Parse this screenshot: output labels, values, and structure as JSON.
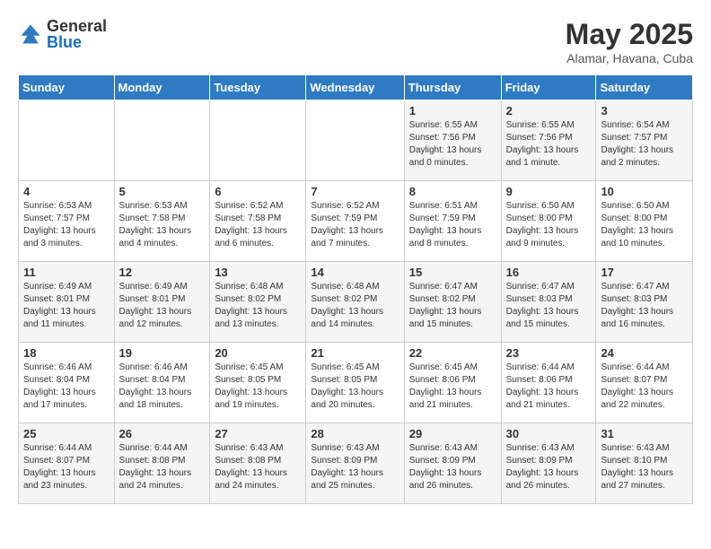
{
  "logo": {
    "general": "General",
    "blue": "Blue"
  },
  "title": "May 2025",
  "location": "Alamar, Havana, Cuba",
  "weekdays": [
    "Sunday",
    "Monday",
    "Tuesday",
    "Wednesday",
    "Thursday",
    "Friday",
    "Saturday"
  ],
  "weeks": [
    [
      {
        "day": "",
        "info": ""
      },
      {
        "day": "",
        "info": ""
      },
      {
        "day": "",
        "info": ""
      },
      {
        "day": "",
        "info": ""
      },
      {
        "day": "1",
        "info": "Sunrise: 6:55 AM\nSunset: 7:56 PM\nDaylight: 13 hours\nand 0 minutes."
      },
      {
        "day": "2",
        "info": "Sunrise: 6:55 AM\nSunset: 7:56 PM\nDaylight: 13 hours\nand 1 minute."
      },
      {
        "day": "3",
        "info": "Sunrise: 6:54 AM\nSunset: 7:57 PM\nDaylight: 13 hours\nand 2 minutes."
      }
    ],
    [
      {
        "day": "4",
        "info": "Sunrise: 6:53 AM\nSunset: 7:57 PM\nDaylight: 13 hours\nand 3 minutes."
      },
      {
        "day": "5",
        "info": "Sunrise: 6:53 AM\nSunset: 7:58 PM\nDaylight: 13 hours\nand 4 minutes."
      },
      {
        "day": "6",
        "info": "Sunrise: 6:52 AM\nSunset: 7:58 PM\nDaylight: 13 hours\nand 6 minutes."
      },
      {
        "day": "7",
        "info": "Sunrise: 6:52 AM\nSunset: 7:59 PM\nDaylight: 13 hours\nand 7 minutes."
      },
      {
        "day": "8",
        "info": "Sunrise: 6:51 AM\nSunset: 7:59 PM\nDaylight: 13 hours\nand 8 minutes."
      },
      {
        "day": "9",
        "info": "Sunrise: 6:50 AM\nSunset: 8:00 PM\nDaylight: 13 hours\nand 9 minutes."
      },
      {
        "day": "10",
        "info": "Sunrise: 6:50 AM\nSunset: 8:00 PM\nDaylight: 13 hours\nand 10 minutes."
      }
    ],
    [
      {
        "day": "11",
        "info": "Sunrise: 6:49 AM\nSunset: 8:01 PM\nDaylight: 13 hours\nand 11 minutes."
      },
      {
        "day": "12",
        "info": "Sunrise: 6:49 AM\nSunset: 8:01 PM\nDaylight: 13 hours\nand 12 minutes."
      },
      {
        "day": "13",
        "info": "Sunrise: 6:48 AM\nSunset: 8:02 PM\nDaylight: 13 hours\nand 13 minutes."
      },
      {
        "day": "14",
        "info": "Sunrise: 6:48 AM\nSunset: 8:02 PM\nDaylight: 13 hours\nand 14 minutes."
      },
      {
        "day": "15",
        "info": "Sunrise: 6:47 AM\nSunset: 8:02 PM\nDaylight: 13 hours\nand 15 minutes."
      },
      {
        "day": "16",
        "info": "Sunrise: 6:47 AM\nSunset: 8:03 PM\nDaylight: 13 hours\nand 15 minutes."
      },
      {
        "day": "17",
        "info": "Sunrise: 6:47 AM\nSunset: 8:03 PM\nDaylight: 13 hours\nand 16 minutes."
      }
    ],
    [
      {
        "day": "18",
        "info": "Sunrise: 6:46 AM\nSunset: 8:04 PM\nDaylight: 13 hours\nand 17 minutes."
      },
      {
        "day": "19",
        "info": "Sunrise: 6:46 AM\nSunset: 8:04 PM\nDaylight: 13 hours\nand 18 minutes."
      },
      {
        "day": "20",
        "info": "Sunrise: 6:45 AM\nSunset: 8:05 PM\nDaylight: 13 hours\nand 19 minutes."
      },
      {
        "day": "21",
        "info": "Sunrise: 6:45 AM\nSunset: 8:05 PM\nDaylight: 13 hours\nand 20 minutes."
      },
      {
        "day": "22",
        "info": "Sunrise: 6:45 AM\nSunset: 8:06 PM\nDaylight: 13 hours\nand 21 minutes."
      },
      {
        "day": "23",
        "info": "Sunrise: 6:44 AM\nSunset: 8:06 PM\nDaylight: 13 hours\nand 21 minutes."
      },
      {
        "day": "24",
        "info": "Sunrise: 6:44 AM\nSunset: 8:07 PM\nDaylight: 13 hours\nand 22 minutes."
      }
    ],
    [
      {
        "day": "25",
        "info": "Sunrise: 6:44 AM\nSunset: 8:07 PM\nDaylight: 13 hours\nand 23 minutes."
      },
      {
        "day": "26",
        "info": "Sunrise: 6:44 AM\nSunset: 8:08 PM\nDaylight: 13 hours\nand 24 minutes."
      },
      {
        "day": "27",
        "info": "Sunrise: 6:43 AM\nSunset: 8:08 PM\nDaylight: 13 hours\nand 24 minutes."
      },
      {
        "day": "28",
        "info": "Sunrise: 6:43 AM\nSunset: 8:09 PM\nDaylight: 13 hours\nand 25 minutes."
      },
      {
        "day": "29",
        "info": "Sunrise: 6:43 AM\nSunset: 8:09 PM\nDaylight: 13 hours\nand 26 minutes."
      },
      {
        "day": "30",
        "info": "Sunrise: 6:43 AM\nSunset: 8:09 PM\nDaylight: 13 hours\nand 26 minutes."
      },
      {
        "day": "31",
        "info": "Sunrise: 6:43 AM\nSunset: 8:10 PM\nDaylight: 13 hours\nand 27 minutes."
      }
    ]
  ]
}
